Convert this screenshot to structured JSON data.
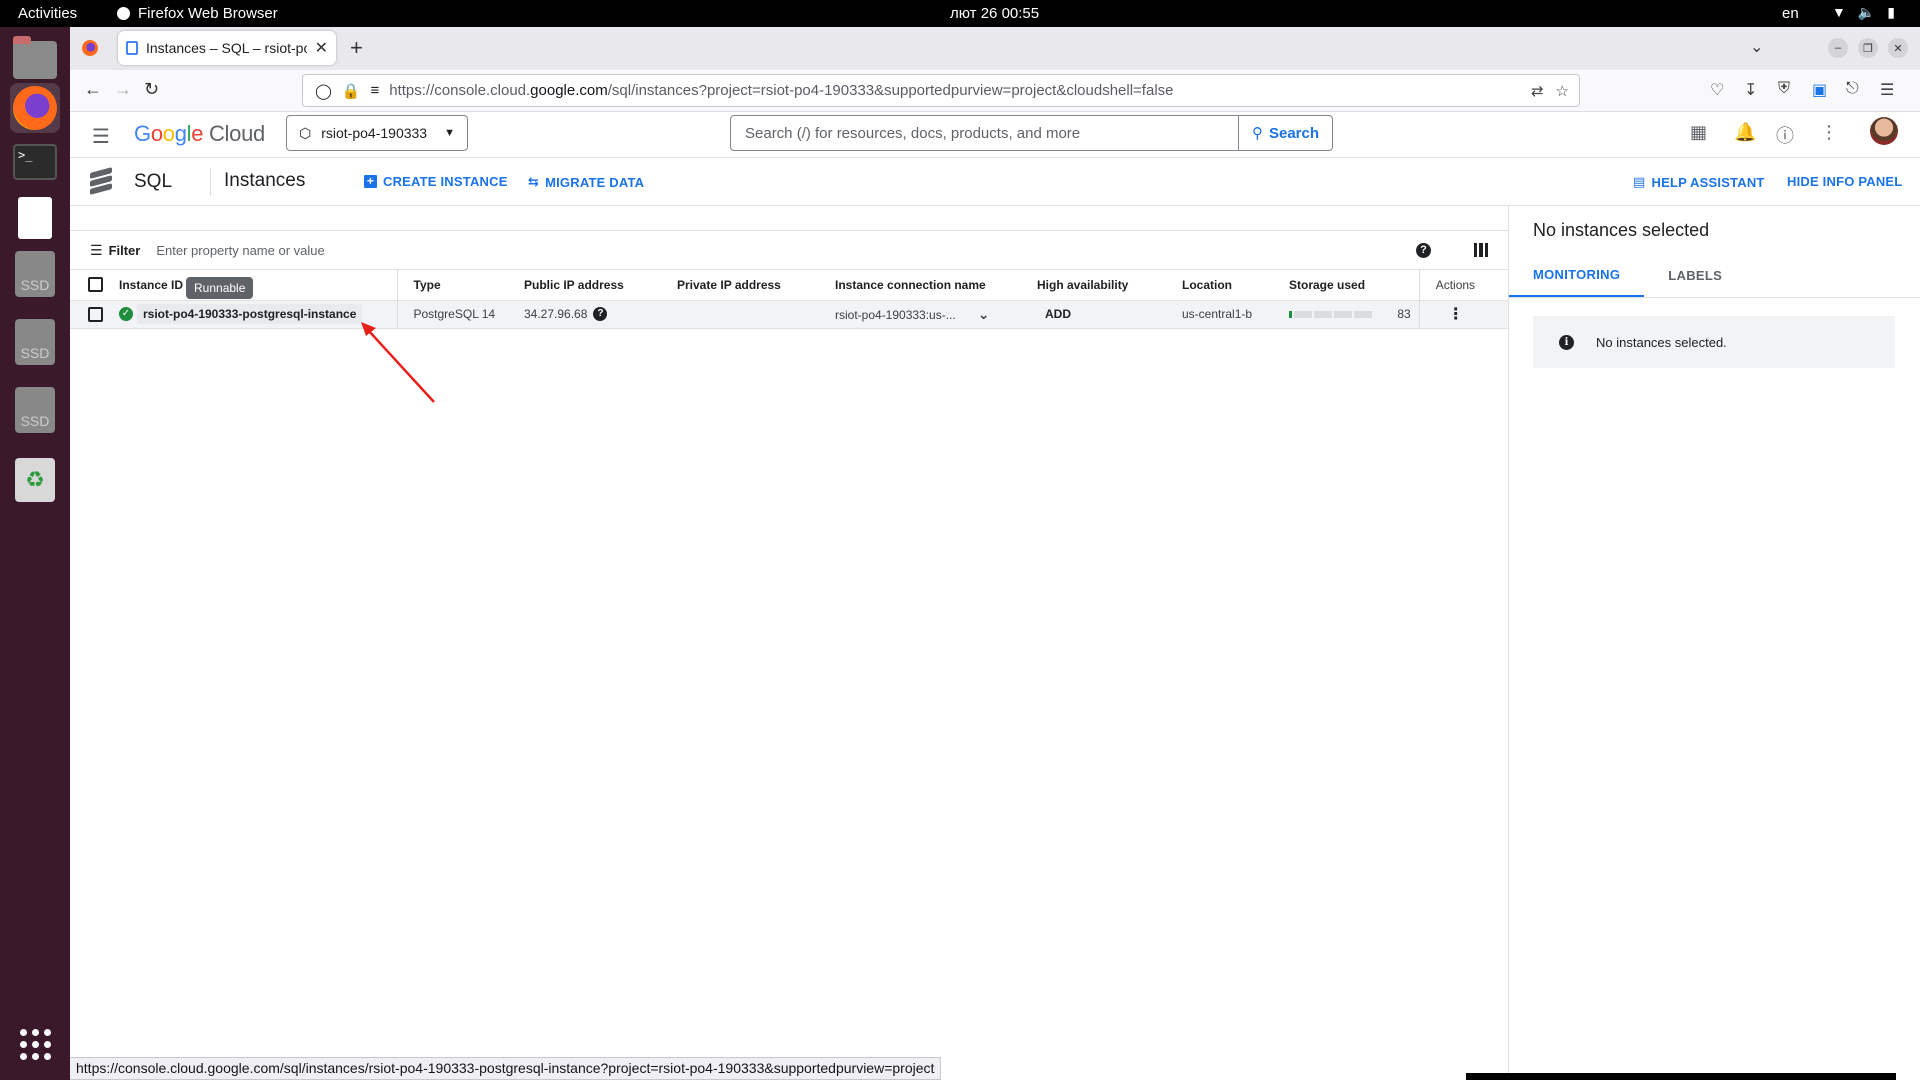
{
  "os": {
    "activities": "Activities",
    "app_name": "Firefox Web Browser",
    "clock": "лют 26  00:55",
    "lang": "en",
    "ssd_label": "SSD"
  },
  "browser": {
    "tab_title": "Instances – SQL – rsiot-po",
    "url_prefix": "https://console.cloud.",
    "url_domain": "google.com",
    "url_rest": "/sql/instances?project=rsiot-po4-190333&supportedpurview=project&cloudshell=false",
    "status_url": "https://console.cloud.google.com/sql/instances/rsiot-po4-190333-postgresql-instance?project=rsiot-po4-190333&supportedpurview=project"
  },
  "console": {
    "logo_google": [
      "G",
      "o",
      "o",
      "g",
      "l",
      "e"
    ],
    "logo_cloud": "Cloud",
    "project": "rsiot-po4-190333",
    "search_placeholder": "Search (/) for resources, docs, products, and more",
    "search_button": "Search"
  },
  "sql_header": {
    "product": "SQL",
    "page_title": "Instances",
    "create_instance": "CREATE INSTANCE",
    "migrate_data": "MIGRATE DATA",
    "help_assistant": "HELP ASSISTANT",
    "hide_info_panel": "HIDE INFO PANEL"
  },
  "filter": {
    "label": "Filter",
    "placeholder": "Enter property name or value"
  },
  "table": {
    "headers": {
      "instance_id": "Instance ID",
      "type": "Type",
      "public_ip": "Public IP address",
      "private_ip": "Private IP address",
      "connection_name": "Instance connection name",
      "high_availability": "High availability",
      "location": "Location",
      "storage_used": "Storage used",
      "actions": "Actions"
    },
    "rows": [
      {
        "instance_id": "rsiot-po4-190333-postgresql-instance",
        "status": "Runnable",
        "type": "PostgreSQL 14",
        "public_ip": "34.27.96.68",
        "private_ip": "",
        "connection_name": "rsiot-po4-190333:us-...",
        "high_availability": "ADD",
        "location": "us-central1-b",
        "storage_used": "83",
        "storage_fraction": 0.03
      }
    ]
  },
  "tooltip": "Runnable",
  "info_panel": {
    "title": "No instances selected",
    "tabs": [
      "MONITORING",
      "LABELS"
    ],
    "message": "No instances selected."
  },
  "colors": {
    "accent": "#1a73e8",
    "status_ok": "#1e8e3e",
    "arrow": "#e8201a"
  }
}
